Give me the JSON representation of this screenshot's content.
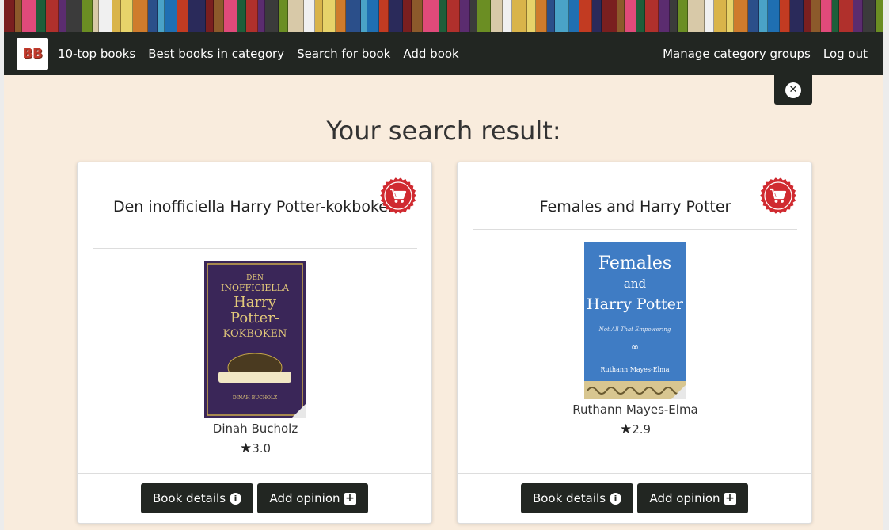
{
  "header": {
    "brand": "BB",
    "nav": {
      "top_books": "10-top books",
      "best_in_category": "Best books in category",
      "search": "Search for book",
      "add_book": "Add book",
      "manage_groups": "Manage category groups",
      "logout": "Log out"
    }
  },
  "main": {
    "heading": "Your search result:",
    "close_icon": "close-icon"
  },
  "results": [
    {
      "title": "Den inofficiella Harry Potter-kokboken",
      "author": "Dinah Bucholz",
      "rating": "3.0",
      "cover": {
        "line1": "DEN",
        "line2": "INOFFICIELLA",
        "line3": "Harry",
        "line4": "Potter-",
        "line5": "KOKBOKEN",
        "author": "DINAH BUCHOLZ",
        "color": "#3a2658"
      },
      "details_label": "Book details",
      "opinion_label": "Add opinion"
    },
    {
      "title": "Females and Harry Potter",
      "author": "Ruthann Mayes-Elma",
      "rating": "2.9",
      "cover": {
        "line1": "Females",
        "line2": "and",
        "line3": "Harry Potter",
        "line4": "Not All That Empowering",
        "line5": "Ruthann Mayes-Elma",
        "color": "#3f7cc4"
      },
      "details_label": "Book details",
      "opinion_label": "Add opinion"
    }
  ],
  "colors": {
    "navbar": "#222622",
    "page_bg": "#f9ecdd",
    "cart_badge": "#d02a30"
  }
}
